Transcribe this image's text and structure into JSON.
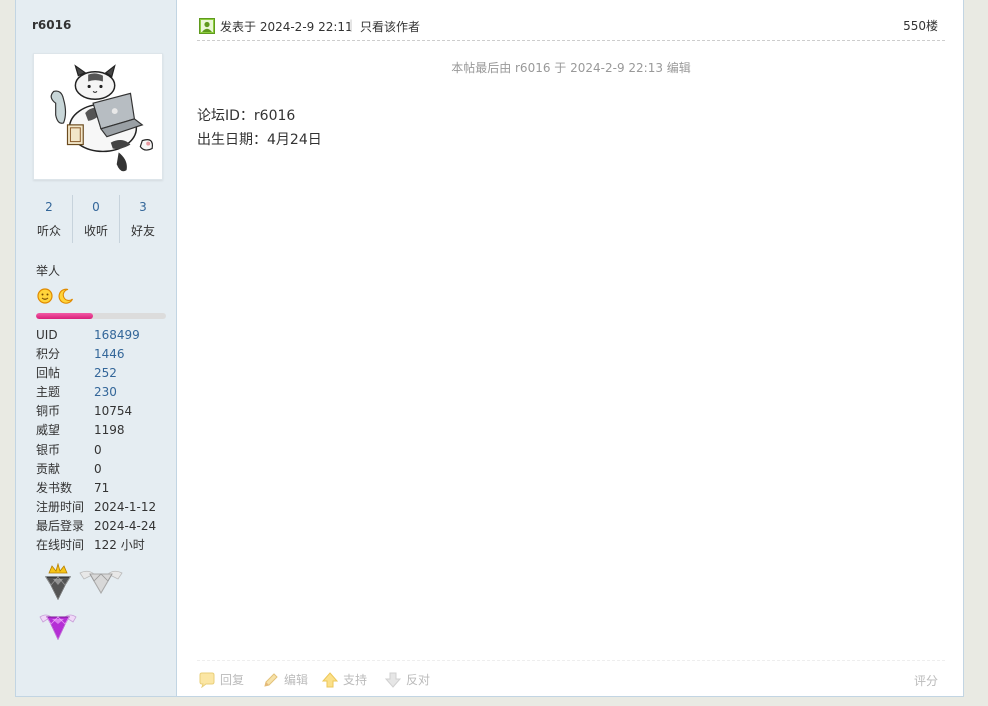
{
  "user": {
    "name": "r6016",
    "stats": [
      {
        "num": "2",
        "label": "听众"
      },
      {
        "num": "0",
        "label": "收听"
      },
      {
        "num": "3",
        "label": "好友"
      }
    ],
    "group": "举人",
    "rank_icons": [
      "smiley-icon",
      "moon-icon"
    ],
    "level_progress": 0.44,
    "info": [
      {
        "key": "UID",
        "value": "168499",
        "link": true
      },
      {
        "key": "积分",
        "value": "1446",
        "link": true
      },
      {
        "key": "回帖",
        "value": "252",
        "link": true
      },
      {
        "key": "主题",
        "value": "230",
        "link": true
      },
      {
        "key": "铜币",
        "value": "10754",
        "link": false
      },
      {
        "key": "威望",
        "value": "1198",
        "link": false
      },
      {
        "key": "银币",
        "value": "0",
        "link": false
      },
      {
        "key": "贡献",
        "value": "0",
        "link": false
      },
      {
        "key": "发书数",
        "value": "71",
        "link": false
      },
      {
        "key": "注册时间",
        "value": "2024-1-12",
        "link": false
      },
      {
        "key": "最后登录",
        "value": "2024-4-24",
        "link": false
      },
      {
        "key": "在线时间",
        "value": "122 小时",
        "link": false
      }
    ],
    "medals": [
      "crown-diamond-medal",
      "winged-diamond-medal",
      "purple-diamond-medal"
    ]
  },
  "post": {
    "time": "发表于 2024-2-9 22:11",
    "separator": "|",
    "only_author": "只看该作者",
    "floor": "550楼",
    "edit_note": "本帖最后由 r6016 于 2024-2-9 22:13 编辑",
    "content": [
      "论坛ID：r6016",
      "出生日期：4月24日"
    ]
  },
  "actions": {
    "reply": "回复",
    "edit": "编辑",
    "support": "支持",
    "oppose": "反对",
    "rate": "评分"
  },
  "colors": {
    "sidebar_bg": "#e5edf2",
    "link": "#336699",
    "progress": "#e23c8f"
  }
}
